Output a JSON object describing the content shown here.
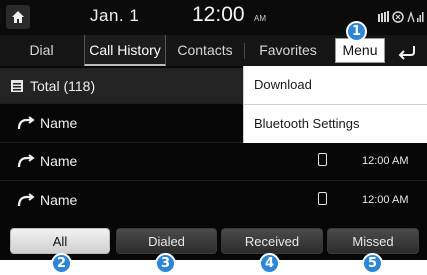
{
  "status_bar": {
    "date": "Jan.  1",
    "time": "12:00",
    "ampm": "AM"
  },
  "tabs": [
    {
      "label": "Dial"
    },
    {
      "label": "Call History"
    },
    {
      "label": "Contacts"
    },
    {
      "label": "Favorites"
    }
  ],
  "toolbar": {
    "menu_label": "Menu"
  },
  "list": {
    "total_label": "Total (118)",
    "rows": [
      {
        "name": "Name",
        "time": ""
      },
      {
        "name": "Name",
        "time": "12:00 AM"
      },
      {
        "name": "Name",
        "time": "12:00 AM"
      }
    ]
  },
  "dropdown": {
    "items": [
      {
        "label": "Download"
      },
      {
        "label": "Bluetooth Settings"
      }
    ]
  },
  "filters": [
    {
      "label": "All"
    },
    {
      "label": "Dialed"
    },
    {
      "label": "Received"
    },
    {
      "label": "Missed"
    }
  ],
  "callouts": [
    "1",
    "2",
    "3",
    "4",
    "5"
  ],
  "colors": {
    "callout": "#2e86d6",
    "background": "#070707",
    "active_button": "#e6e6e6"
  }
}
